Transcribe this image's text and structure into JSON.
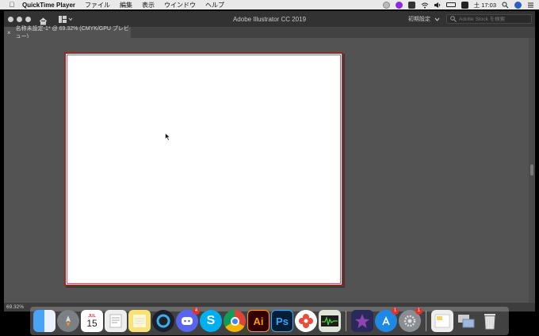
{
  "menubar": {
    "app_name": "QuickTime Player",
    "items": [
      "ファイル",
      "編集",
      "表示",
      "ウインドウ",
      "ヘルプ"
    ],
    "clock": "土 17:03"
  },
  "window": {
    "title": "Adobe Illustrator CC 2019",
    "workspace_label": "初期設定",
    "stock_search_placeholder": "Adobe Stock を検索"
  },
  "document": {
    "tab_label": "名称未設定-1* @ 69.32% (CMYK/GPU プレビュー)",
    "close_glyph": "×"
  },
  "status": {
    "zoom": "69.32%"
  },
  "dock": {
    "calendar_month": "JUL",
    "calendar_day": "15",
    "illustrator_label": "Ai",
    "photoshop_label": "Ps",
    "badges": {
      "discord": "4",
      "app_store": "1",
      "system_prefs": "1"
    }
  },
  "colors": {
    "app_bg": "#535353",
    "artboard_border": "#8e2b2b",
    "illustrator": "#ff9a00",
    "photoshop": "#31a8ff"
  }
}
